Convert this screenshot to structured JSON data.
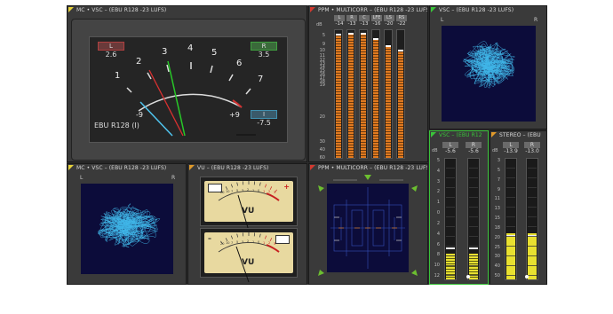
{
  "panels": {
    "vu_main": {
      "title": "MC • VSC – (EBU R128 -23 LUFS)",
      "left_label": "L",
      "left_value": "2.6",
      "right_label": "R",
      "right_value": "3.5",
      "i_label": "I",
      "i_value": "-7.5",
      "mode": "EBU R128 (I)",
      "scale": [
        "1",
        "2",
        "3",
        "4",
        "5",
        "6",
        "7"
      ],
      "min_label": "-9",
      "max_label": "+9"
    },
    "ppm": {
      "title": "PPM • MULTICORR – (EBU R128 -23 LUFS)",
      "channels": [
        {
          "label": "L",
          "value": "-14",
          "level": 0.97
        },
        {
          "label": "R",
          "value": "-13",
          "level": 0.98
        },
        {
          "label": "C",
          "value": "-13",
          "level": 0.98
        },
        {
          "label": "LFE",
          "value": "-16",
          "level": 0.94
        },
        {
          "label": "LS",
          "value": "-20",
          "level": 0.88
        },
        {
          "label": "RS",
          "value": "-22",
          "level": 0.85
        }
      ],
      "db_label": "dB",
      "scale": [
        "5",
        "9",
        "10",
        "11",
        "12",
        "13",
        "14",
        "15",
        "16",
        "17",
        "18",
        "19",
        "20",
        "30",
        "40",
        "60"
      ]
    },
    "vsc_top": {
      "title": "VSC – (EBU R128 -23 LUFS)",
      "left": "L",
      "right": "R"
    },
    "vsc_bottom_left": {
      "title": "MC • VSC – (EBU R128 -23 LUFS)",
      "left": "L",
      "right": "R"
    },
    "vu_pair": {
      "title": "VU – (EBU R128 -23 LUFS)",
      "meter_label": "VU",
      "scale": [
        "20",
        "10",
        "7",
        "5",
        "3",
        "2",
        "1",
        "0",
        "1",
        "2",
        "3"
      ],
      "plus": "+",
      "minus": "–"
    },
    "multicorr": {
      "title": "PPM • MULTICORR – (EBU R128 -23 LUFS)"
    },
    "vsc_r128": {
      "title": "VSC – (EBU R12",
      "db_label": "dB",
      "channels": [
        {
          "label": "L",
          "value": "-5.6",
          "level": 0.21
        },
        {
          "label": "R",
          "value": "-5.6",
          "level": 0.21
        }
      ],
      "scale": [
        "5",
        "4",
        "3",
        "2",
        "1",
        "0",
        "2",
        "4",
        "6",
        "8",
        "10",
        "12"
      ]
    },
    "stereo": {
      "title": "STEREO – (EBU",
      "db_label": "dB",
      "channels": [
        {
          "label": "L",
          "value": "-13.9",
          "level": 0.38
        },
        {
          "label": "R",
          "value": "-13.0",
          "level": 0.38
        }
      ],
      "scale": [
        "3",
        "5",
        "7",
        "9",
        "11",
        "13",
        "15",
        "18",
        "20",
        "25",
        "30",
        "40",
        "50"
      ]
    }
  },
  "colors": {
    "trace": "#3fb6e8",
    "meter_orange": "#e07a20",
    "meter_yellow": "#e8e030",
    "needle_red": "#d93030",
    "needle_green": "#28c828",
    "needle_cyan": "#4fc4ee",
    "vu_face": "#e8d9a0"
  }
}
